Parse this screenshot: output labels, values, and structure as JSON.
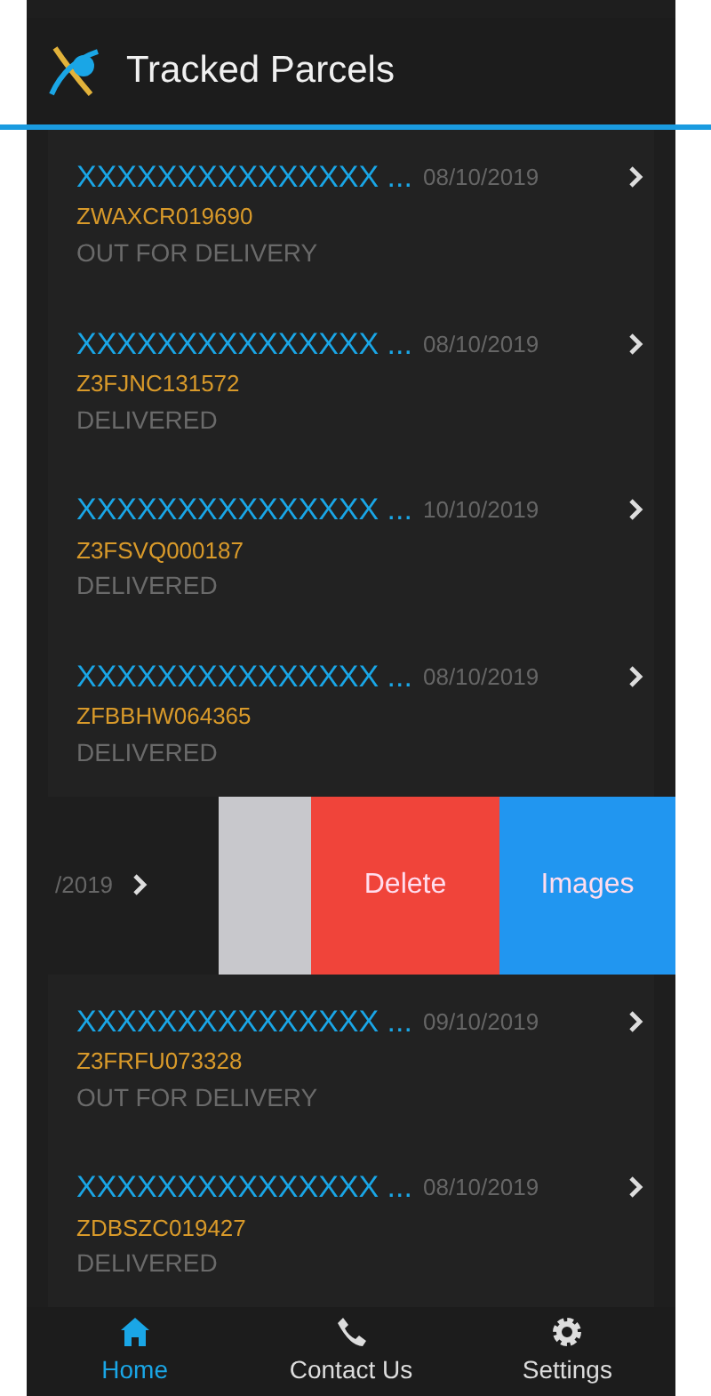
{
  "app_bar": {
    "title": "Tracked Parcels"
  },
  "parcels": [
    {
      "kind": "normal",
      "name": "XXXXXXXXXXXXXXX ...",
      "date": "08/10/2019",
      "reference": "ZWAXCR019690",
      "status": "OUT FOR DELIVERY"
    },
    {
      "kind": "normal",
      "name": "XXXXXXXXXXXXXXX ...",
      "date": "08/10/2019",
      "reference": "Z3FJNC131572",
      "status": "DELIVERED"
    },
    {
      "kind": "normal",
      "name": "XXXXXXXXXXXXXXX ...",
      "date": "10/10/2019",
      "reference": "Z3FSVQ000187",
      "status": "DELIVERED"
    },
    {
      "kind": "normal",
      "name": "XXXXXXXXXXXXXXX ...",
      "date": "08/10/2019",
      "reference": "ZFBBHW064365",
      "status": "DELIVERED"
    },
    {
      "kind": "swiped",
      "date": "/2019",
      "actions": [
        {
          "kind": "blank"
        },
        {
          "kind": "delete",
          "label": "Delete"
        },
        {
          "kind": "images",
          "label": "Images"
        }
      ]
    },
    {
      "kind": "normal",
      "name": "XXXXXXXXXXXXXXX ...",
      "date": "09/10/2019",
      "reference": "Z3FRFU073328",
      "status": "OUT FOR DELIVERY"
    },
    {
      "kind": "normal",
      "name": "XXXXXXXXXXXXXXX ...",
      "date": "08/10/2019",
      "reference": "ZDBSZC019427",
      "status": "DELIVERED"
    }
  ],
  "bottom_nav": [
    {
      "kind": "home",
      "label": "Home",
      "selected": true
    },
    {
      "kind": "phone",
      "label": "Contact Us",
      "selected": false
    },
    {
      "kind": "settings",
      "label": "Settings",
      "selected": false
    }
  ]
}
